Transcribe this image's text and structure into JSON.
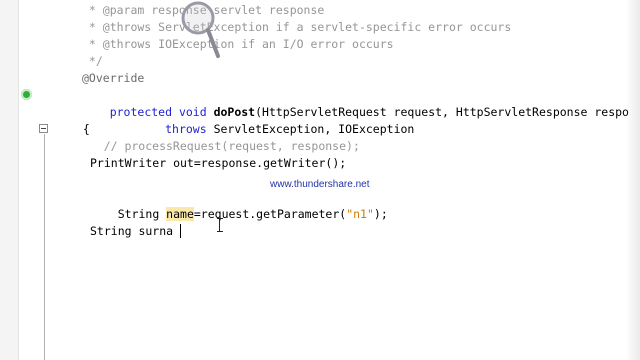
{
  "editor": {
    "lines": {
      "l1": " * @param response servlet response",
      "l2": " * @throws ServletException if a servlet-specific error occurs",
      "l3": " * @throws IOException if an I/O error occurs",
      "l4": " */",
      "l5": "@Override",
      "l6a": "protected void ",
      "l6b": "doPost",
      "l6c": "(HttpServletRequest request, HttpServletResponse respo",
      "l7a": "        throws ",
      "l7b": "ServletException, IOException",
      "l8": " {",
      "l9": "    // processRequest(request, response);",
      "l10": "PrintWriter out=response.getWriter();",
      "l11a": "String ",
      "l11b": "name",
      "l11c": "=request.getParameter(",
      "l11d": "\"n1\"",
      "l11e": ");",
      "l12": "String surna"
    },
    "watermark": "www.thundershare.net"
  },
  "icons": {
    "override_marker": "override-gutter-icon",
    "fold_toggle": "fold-collapse-icon",
    "magnifier": "zoom-lens-icon",
    "cursor": "text-ibeam-cursor-icon"
  },
  "colors": {
    "keyword": "#1f23d1",
    "comment": "#969696",
    "string": "#ce7b00",
    "highlight": "#f9e8a9",
    "marker": "#2fae3c"
  }
}
